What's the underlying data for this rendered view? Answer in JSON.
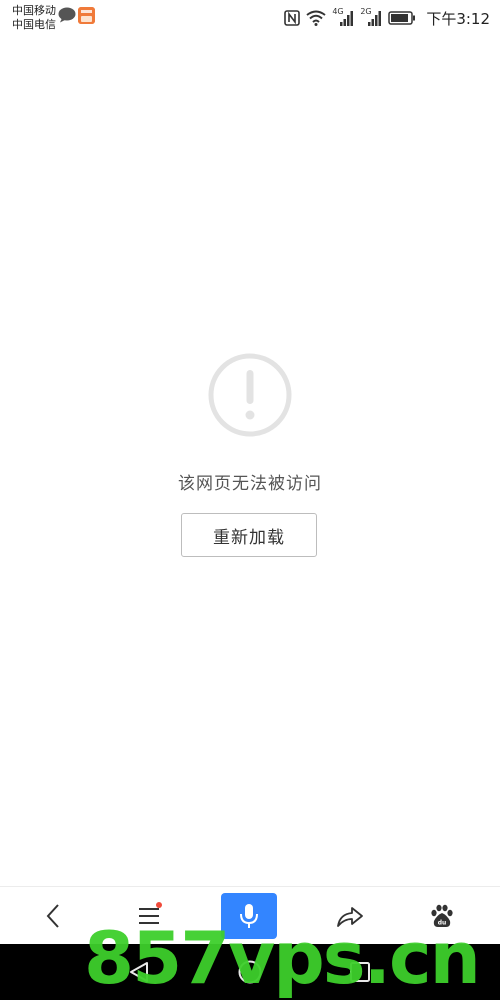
{
  "status_bar": {
    "carrier_1": "中国移动",
    "carrier_2": "中国电信",
    "network_1": "4G",
    "network_2": "2G",
    "time": "下午3:12",
    "icons": [
      "message-icon",
      "app-notification-icon",
      "nfc-icon",
      "wifi-icon",
      "signal-icon",
      "signal-icon",
      "battery-icon"
    ]
  },
  "error": {
    "icon": "exclamation-circle-icon",
    "message": "该网页无法被访问",
    "reload_label": "重新加载"
  },
  "toolbar": {
    "items": [
      "back-icon",
      "menu-icon",
      "voice-search-icon",
      "share-icon",
      "baidu-logo-icon"
    ],
    "accent_color": "#3385ff",
    "menu_badge_color": "#f04a3a"
  },
  "nav_bar": {
    "items": [
      "nav-back-icon",
      "nav-home-icon",
      "nav-recent-apps-icon"
    ]
  },
  "watermark": {
    "text": "857vps.cn",
    "color": "#3ecf2c"
  }
}
